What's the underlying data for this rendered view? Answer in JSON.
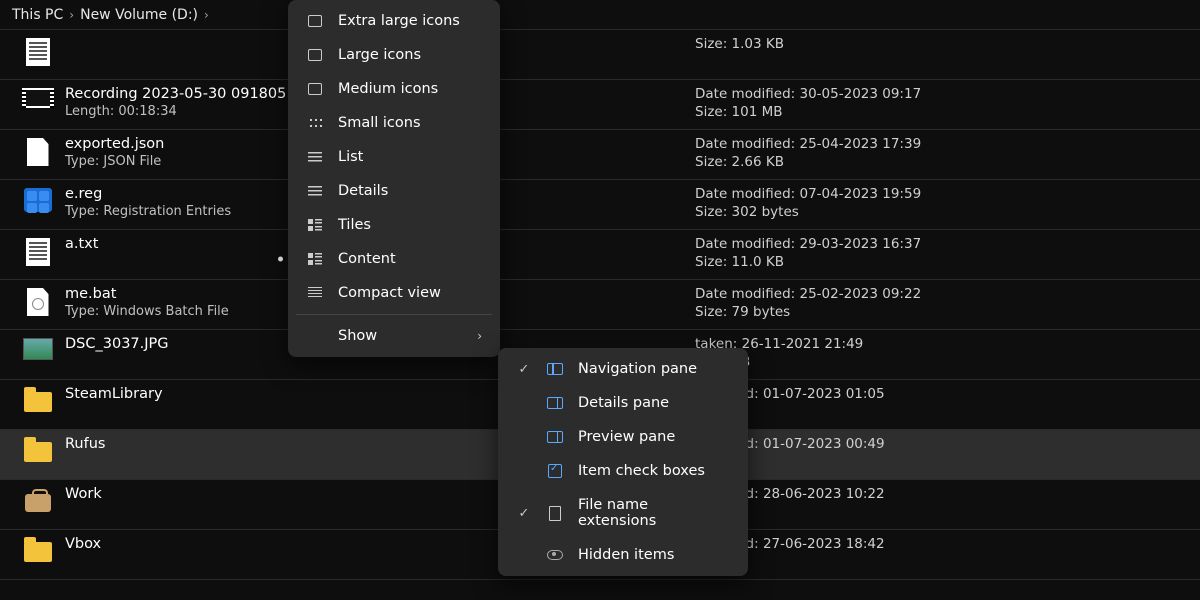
{
  "breadcrumb": {
    "a": "This PC",
    "b": "New Volume (D:)"
  },
  "rows": [
    {
      "name": "",
      "sub": "",
      "line1": "",
      "line2": "Size: 1.03 KB",
      "icon": "text"
    },
    {
      "name": "Recording 2023-05-30 091805",
      "sub": "Length: 00:18:34",
      "line1": "Date modified: 30-05-2023 09:17",
      "line2": "Size: 101 MB",
      "icon": "video",
      "peek1": "40",
      "peek2": "0"
    },
    {
      "name": "exported.json",
      "sub": "Type: JSON File",
      "line1": "Date modified: 25-04-2023 17:39",
      "line2": "Size: 2.66 KB",
      "icon": "json"
    },
    {
      "name": "e.reg",
      "sub": "Type: Registration Entries",
      "line1": "Date modified: 07-04-2023 19:59",
      "line2": "Size: 302 bytes",
      "icon": "reg"
    },
    {
      "name": "a.txt",
      "sub": "",
      "line1": "Date modified: 29-03-2023 16:37",
      "line2": "Size: 11.0 KB",
      "icon": "text"
    },
    {
      "name": "me.bat",
      "sub": "Type: Windows Batch File",
      "line1": "Date modified: 25-02-2023 09:22",
      "line2": "Size: 79 bytes",
      "icon": "bat"
    },
    {
      "name": "DSC_3037.JPG",
      "sub": "",
      "line1": "taken: 26-11-2021 21:49",
      "line2": "7.95 MB",
      "icon": "jpg"
    },
    {
      "name": "SteamLibrary",
      "sub": "",
      "line1": "modified: 01-07-2023 01:05",
      "line2": "",
      "icon": "folder"
    },
    {
      "name": "Rufus",
      "sub": "",
      "line1": "modified: 01-07-2023 00:49",
      "line2": "",
      "icon": "folder",
      "sel": true
    },
    {
      "name": "Work",
      "sub": "",
      "line1": "modified: 28-06-2023 10:22",
      "line2": "",
      "icon": "brief"
    },
    {
      "name": "Vbox",
      "sub": "",
      "line1": "modified: 27-06-2023 18:42",
      "line2": "",
      "icon": "folder"
    }
  ],
  "menu": {
    "items": [
      {
        "label": "Extra large icons",
        "ico": "box"
      },
      {
        "label": "Large icons",
        "ico": "box"
      },
      {
        "label": "Medium icons",
        "ico": "box"
      },
      {
        "label": "Small icons",
        "ico": "grid"
      },
      {
        "label": "List",
        "ico": "list"
      },
      {
        "label": "Details",
        "ico": "list"
      },
      {
        "label": "Tiles",
        "ico": "tiles"
      },
      {
        "label": "Content",
        "ico": "tiles",
        "dot": true
      },
      {
        "label": "Compact view",
        "ico": "compact"
      }
    ],
    "show": "Show"
  },
  "submenu": [
    {
      "label": "Navigation pane",
      "checked": true,
      "ico": "pane-l"
    },
    {
      "label": "Details pane",
      "checked": false,
      "ico": "pane-r"
    },
    {
      "label": "Preview pane",
      "checked": false,
      "ico": "pane-r"
    },
    {
      "label": "Item check boxes",
      "checked": false,
      "ico": "chk"
    },
    {
      "label": "File name extensions",
      "checked": true,
      "ico": "doc"
    },
    {
      "label": "Hidden items",
      "checked": false,
      "ico": "eye"
    }
  ]
}
